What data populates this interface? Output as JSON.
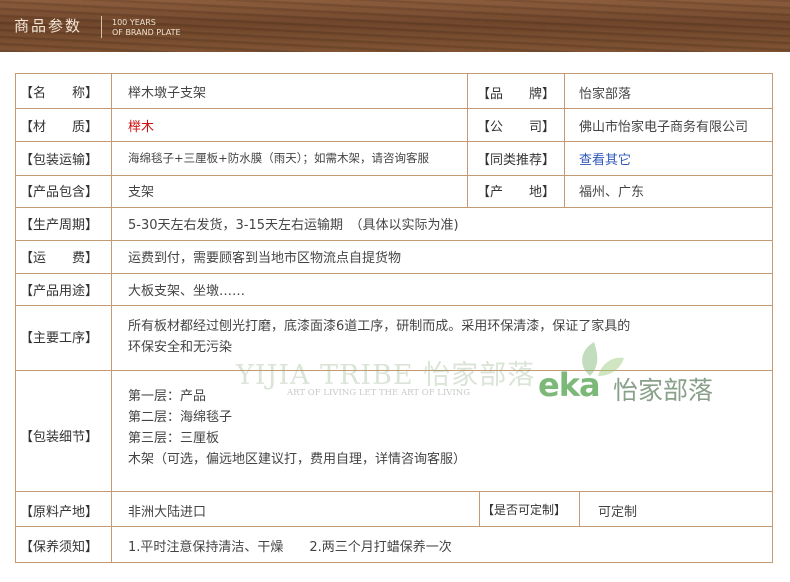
{
  "header": {
    "title": "商品参数",
    "sub1": "100 YEARS",
    "sub2": "OF BRAND PLATE"
  },
  "rows": {
    "name": {
      "label": "【名　　称】",
      "value": "榉木墩子支架"
    },
    "brand": {
      "label": "【品　　牌】",
      "value": "怡家部落"
    },
    "material": {
      "label": "【材　　质】",
      "value": "榉木"
    },
    "company": {
      "label": "【公　　司】",
      "value": "佛山市怡家电子商务有限公司"
    },
    "pack_ship": {
      "label": "【包装运输】",
      "value": "海绵毯子+三厘板+防水膜（雨天）；如需木架，请咨询客服"
    },
    "similar": {
      "label": "【同类推荐】",
      "value": "查看其它"
    },
    "includes": {
      "label": "【产品包含】",
      "value": "支架"
    },
    "origin": {
      "label": "【产　　地】",
      "value": "福州、广东"
    },
    "cycle": {
      "label": "【生产周期】",
      "value": "5-30天左右发货，3-15天左右运输期　（具体以实际为准)"
    },
    "freight": {
      "label": "【运　　费】",
      "value": "运费到付，需要顾客到当地市区物流点自提货物"
    },
    "usage": {
      "label": "【产品用途】",
      "value": "大板支架、坐墩……"
    },
    "process": {
      "label": "【主要工序】",
      "line1": "所有板材都经过刨光打磨，底漆面漆6道工序，研制而成。采用环保清漆，保证了家具的",
      "line2": "环保安全和无污染"
    },
    "packing": {
      "label": "【包装细节】",
      "lines": [
        "第一层：产品",
        "第二层：海绵毯子",
        "第三层：三厘板",
        "木架（可选，偏远地区建议打，费用自理，详情咨询客服）"
      ]
    },
    "source": {
      "label": "【原料产地】",
      "value": "非洲大陆进口"
    },
    "custom": {
      "label": "【是否可定制】",
      "value": "可定制"
    },
    "care": {
      "label": "【保养须知】",
      "value": "1.平时注意保持清洁、干燥　　2.两三个月打蜡保养一次"
    }
  },
  "watermark": {
    "main": "YIJIA TRIBE 怡家部落",
    "sub": "ART OF LIVING LET THE ART OF LIVING",
    "logo_en": "eka",
    "logo_cn": "怡家部落"
  },
  "colors": {
    "border": "#c39a74",
    "accent_red": "#d01010",
    "link_blue": "#2f58b8"
  }
}
